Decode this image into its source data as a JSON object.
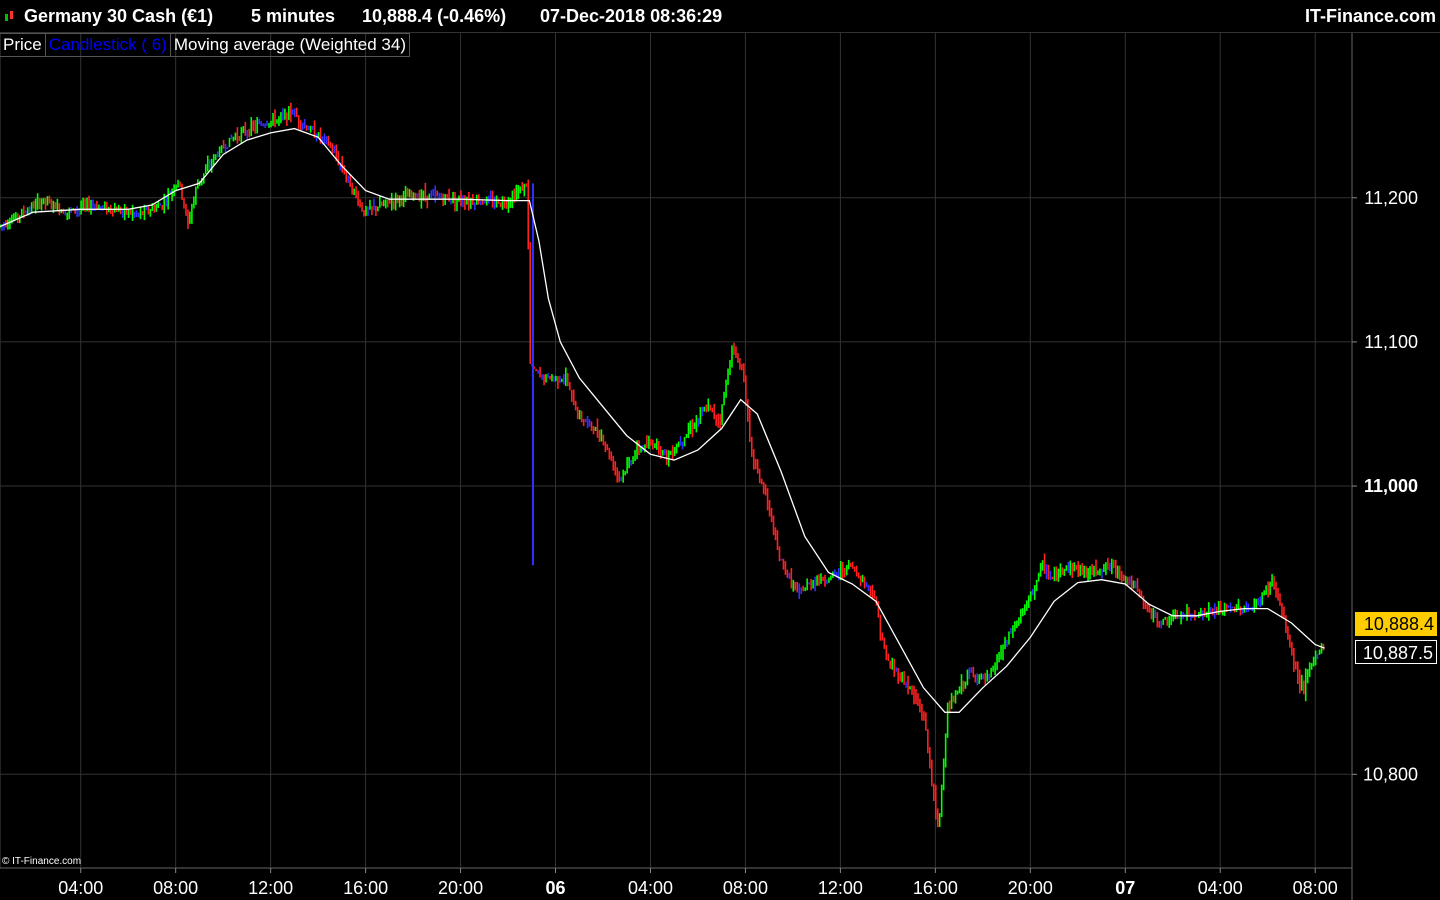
{
  "header": {
    "instrument": "Germany 30 Cash (€1)",
    "timeframe": "5 minutes",
    "last_change": "10,888.4 (-0.46%)",
    "datetime": "07-Dec-2018 08:36:29",
    "brand": "IT-Finance.com"
  },
  "legend": {
    "price_label": "Price",
    "candle_label": "Candlestick ( 6)",
    "ma_label": "Moving average (Weighted 34)"
  },
  "copyright": "© IT-Finance.com",
  "price_tags": {
    "last": "10,888.4",
    "ma": "10,887.5"
  },
  "colors": {
    "up": "#00ff00",
    "down": "#ff2020",
    "neutral": "#3030ff",
    "ma": "#ffffff",
    "grid": "#333333",
    "last_tag": "#ffcc00"
  },
  "chart_data": {
    "type": "candlestick",
    "title": "Germany 30 Cash (€1)",
    "ylim": [
      10735,
      11315
    ],
    "y_ticks": [
      {
        "value": 11200,
        "label": "11,200",
        "bold": false
      },
      {
        "value": 11100,
        "label": "11,100",
        "bold": false
      },
      {
        "value": 11000,
        "label": "11,000",
        "bold": true
      },
      {
        "value": 10800,
        "label": "10,800",
        "bold": false
      }
    ],
    "x_ticks": [
      {
        "t": 4,
        "label": "04:00",
        "bold": false
      },
      {
        "t": 8,
        "label": "08:00",
        "bold": false
      },
      {
        "t": 12,
        "label": "12:00",
        "bold": false
      },
      {
        "t": 16,
        "label": "16:00",
        "bold": false
      },
      {
        "t": 20,
        "label": "20:00",
        "bold": false
      },
      {
        "t": 24,
        "label": "06",
        "bold": true
      },
      {
        "t": 28,
        "label": "04:00",
        "bold": false
      },
      {
        "t": 32,
        "label": "08:00",
        "bold": false
      },
      {
        "t": 36,
        "label": "12:00",
        "bold": false
      },
      {
        "t": 40,
        "label": "16:00",
        "bold": false
      },
      {
        "t": 44,
        "label": "20:00",
        "bold": false
      },
      {
        "t": 48,
        "label": "07",
        "bold": true
      },
      {
        "t": 52,
        "label": "04:00",
        "bold": false
      },
      {
        "t": 56,
        "label": "08:00",
        "bold": false
      }
    ],
    "x_range": [
      0.6,
      57.55
    ],
    "price_path": [
      [
        0.6,
        11180
      ],
      [
        1.5,
        11188
      ],
      [
        2.5,
        11198
      ],
      [
        3.5,
        11190
      ],
      [
        4.5,
        11195
      ],
      [
        5.5,
        11192
      ],
      [
        6.5,
        11188
      ],
      [
        7.5,
        11195
      ],
      [
        8.2,
        11212
      ],
      [
        8.6,
        11182
      ],
      [
        9.0,
        11210
      ],
      [
        9.8,
        11230
      ],
      [
        10.5,
        11242
      ],
      [
        11.5,
        11250
      ],
      [
        12.5,
        11255
      ],
      [
        13.0,
        11260
      ],
      [
        13.5,
        11250
      ],
      [
        14.5,
        11238
      ],
      [
        15.2,
        11218
      ],
      [
        16.0,
        11190
      ],
      [
        16.8,
        11195
      ],
      [
        17.5,
        11200
      ],
      [
        18.5,
        11202
      ],
      [
        19.5,
        11200
      ],
      [
        20.5,
        11198
      ],
      [
        22.0,
        11197
      ],
      [
        22.9,
        11210
      ],
      [
        23.0,
        11085
      ],
      [
        23.5,
        11075
      ],
      [
        24.5,
        11075
      ],
      [
        25.0,
        11050
      ],
      [
        26.0,
        11035
      ],
      [
        26.8,
        11005
      ],
      [
        27.5,
        11025
      ],
      [
        28.3,
        11030
      ],
      [
        28.8,
        11020
      ],
      [
        29.5,
        11035
      ],
      [
        30.5,
        11055
      ],
      [
        31.0,
        11045
      ],
      [
        31.5,
        11095
      ],
      [
        32.0,
        11080
      ],
      [
        32.3,
        11025
      ],
      [
        33.0,
        10990
      ],
      [
        33.5,
        10950
      ],
      [
        34.3,
        10925
      ],
      [
        35.0,
        10935
      ],
      [
        35.5,
        10935
      ],
      [
        36.5,
        10945
      ],
      [
        37.5,
        10925
      ],
      [
        38.0,
        10880
      ],
      [
        39.0,
        10860
      ],
      [
        39.6,
        10840
      ],
      [
        40.2,
        10760
      ],
      [
        40.6,
        10845
      ],
      [
        41.5,
        10870
      ],
      [
        42.3,
        10865
      ],
      [
        43.0,
        10890
      ],
      [
        44.0,
        10920
      ],
      [
        44.6,
        10945
      ],
      [
        45.0,
        10935
      ],
      [
        45.6,
        10945
      ],
      [
        46.5,
        10940
      ],
      [
        47.5,
        10945
      ],
      [
        48.5,
        10930
      ],
      [
        49.0,
        10915
      ],
      [
        49.5,
        10905
      ],
      [
        50.5,
        10910
      ],
      [
        51.5,
        10912
      ],
      [
        52.5,
        10915
      ],
      [
        53.5,
        10915
      ],
      [
        54.3,
        10935
      ],
      [
        54.8,
        10905
      ],
      [
        55.3,
        10870
      ],
      [
        55.6,
        10860
      ],
      [
        56.0,
        10880
      ],
      [
        56.4,
        10888
      ]
    ],
    "ma_path": [
      [
        0.6,
        11180
      ],
      [
        2.0,
        11190
      ],
      [
        4.0,
        11192
      ],
      [
        6.0,
        11192
      ],
      [
        7.0,
        11195
      ],
      [
        8.0,
        11205
      ],
      [
        9.0,
        11210
      ],
      [
        10.0,
        11230
      ],
      [
        11.0,
        11240
      ],
      [
        12.0,
        11245
      ],
      [
        13.0,
        11248
      ],
      [
        14.0,
        11242
      ],
      [
        15.0,
        11222
      ],
      [
        16.0,
        11205
      ],
      [
        17.0,
        11199
      ],
      [
        18.0,
        11199
      ],
      [
        20.0,
        11199
      ],
      [
        22.0,
        11198
      ],
      [
        22.9,
        11198
      ],
      [
        23.3,
        11170
      ],
      [
        23.7,
        11130
      ],
      [
        24.2,
        11100
      ],
      [
        25.0,
        11075
      ],
      [
        26.0,
        11055
      ],
      [
        27.0,
        11035
      ],
      [
        28.0,
        11022
      ],
      [
        29.0,
        11018
      ],
      [
        30.0,
        11025
      ],
      [
        31.0,
        11040
      ],
      [
        31.8,
        11060
      ],
      [
        32.5,
        11050
      ],
      [
        33.5,
        11010
      ],
      [
        34.5,
        10965
      ],
      [
        35.5,
        10940
      ],
      [
        36.5,
        10932
      ],
      [
        37.5,
        10920
      ],
      [
        38.5,
        10890
      ],
      [
        39.5,
        10860
      ],
      [
        40.4,
        10843
      ],
      [
        41.0,
        10843
      ],
      [
        42.0,
        10860
      ],
      [
        43.0,
        10875
      ],
      [
        44.0,
        10895
      ],
      [
        45.0,
        10920
      ],
      [
        46.0,
        10933
      ],
      [
        47.0,
        10935
      ],
      [
        48.0,
        10932
      ],
      [
        49.0,
        10918
      ],
      [
        50.0,
        10910
      ],
      [
        51.0,
        10910
      ],
      [
        52.0,
        10913
      ],
      [
        53.0,
        10915
      ],
      [
        54.0,
        10915
      ],
      [
        55.0,
        10905
      ],
      [
        56.0,
        10890
      ],
      [
        56.4,
        10887.5
      ]
    ]
  }
}
